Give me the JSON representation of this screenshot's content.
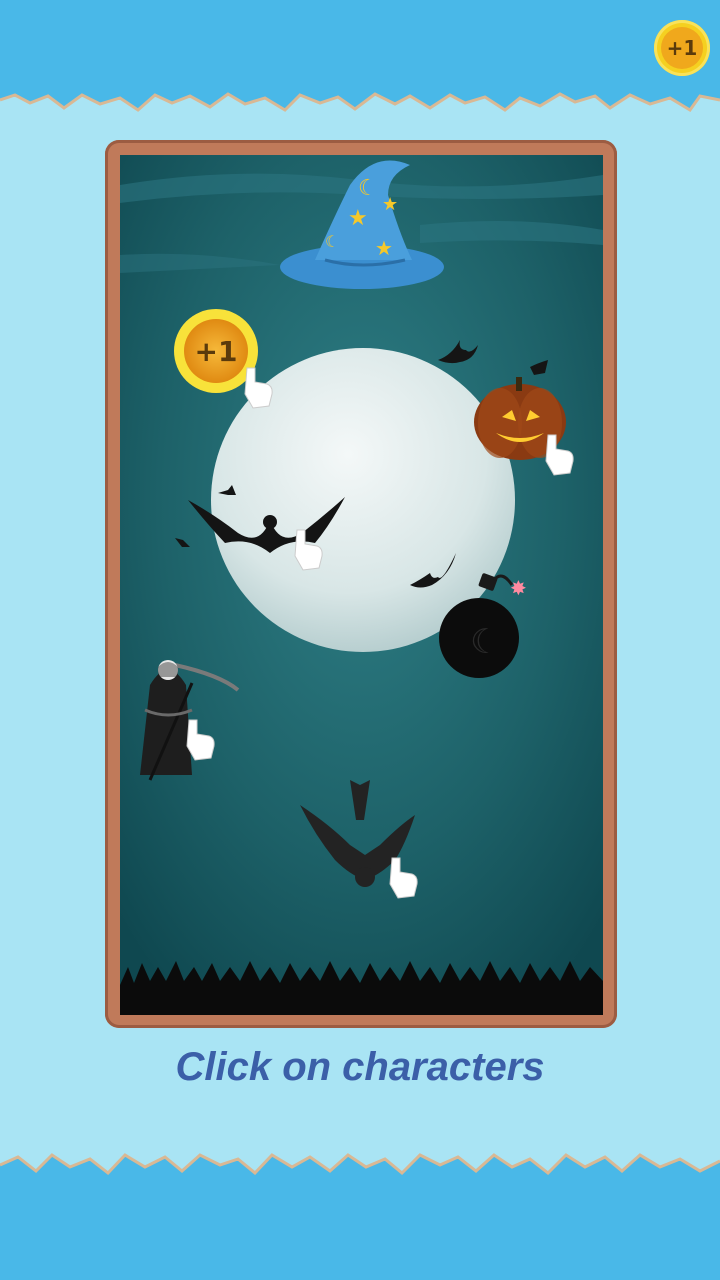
{
  "hud": {
    "coin_label": "+1"
  },
  "scene": {
    "coin_label": "+1",
    "characters": [
      "wizard-hat",
      "coin",
      "pumpkin",
      "bat",
      "bomb",
      "grim-reaper",
      "crow"
    ]
  },
  "caption": "Click on characters",
  "colors": {
    "sky_band": "#49b8e8",
    "background": "#a9e4f4",
    "frame": "#c07a5a",
    "scene_bg": "#1a5c66",
    "caption": "#3b5fa8"
  }
}
